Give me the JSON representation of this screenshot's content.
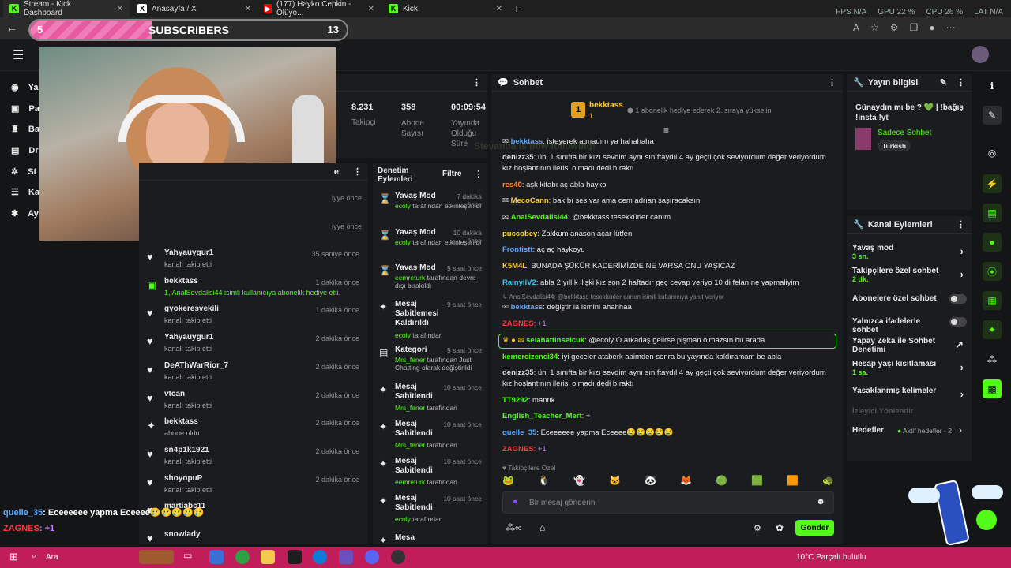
{
  "browser": {
    "tabs": [
      {
        "label": "Stream - Kick Dashboard",
        "icon": "kick-icon"
      },
      {
        "label": "Anasayfa / X",
        "icon": "x-icon"
      },
      {
        "label": "(177) Hayko Cepkin - Ölüyo...",
        "icon": "youtube-icon"
      },
      {
        "label": "Kick",
        "icon": "kick-icon"
      }
    ],
    "stats": {
      "fps": "FPS N/A",
      "gpu": "GPU 22 %",
      "cpu": "CPU 26 %",
      "lat": "LAT N/A"
    }
  },
  "overlay": {
    "subscribers_label": "SUBSCRIBERS",
    "sub_current": "5",
    "sub_goal": "13",
    "chat_line1_user": "quelle_35",
    "chat_line1_text": ": Eceeeeee yapma Eceeee😢😢😢😢😢",
    "chat_line2_user": "ZAGNES",
    "chat_line2_text": ": +1"
  },
  "nav": {
    "items": [
      "Ya",
      "Pa",
      "Ba",
      "Dr",
      "St",
      "Ka",
      "Ay"
    ]
  },
  "stats": [
    {
      "value": "8.231",
      "label": "Takipçi"
    },
    {
      "value": "358",
      "label": "Abone Sayısı"
    },
    {
      "value": "00:09:54",
      "label": "Yayında Olduğu Süre"
    }
  ],
  "feed": {
    "header_suffix": "e",
    "partial_time": "iyye önce",
    "items": [
      {
        "name": "Yahyauygur1",
        "sub": "kanalı takip etti",
        "time": "35 saniye önce",
        "icon": "heart"
      },
      {
        "name": "bekktass",
        "sub": "1, AnalSevdalisi44 isimli kullanıcıya abonelik hediye etti.",
        "time": "1 dakika önce",
        "icon": "gift"
      },
      {
        "name": "gyokeresvekili",
        "sub": "kanalı takip etti",
        "time": "1 dakika önce",
        "icon": "heart"
      },
      {
        "name": "Yahyauygur1",
        "sub": "kanalı takip etti",
        "time": "2 dakika önce",
        "icon": "heart"
      },
      {
        "name": "DeAThWarRior_7",
        "sub": "kanalı takip etti",
        "time": "2 dakika önce",
        "icon": "heart"
      },
      {
        "name": "vtcan",
        "sub": "kanalı takip etti",
        "time": "2 dakika önce",
        "icon": "heart"
      },
      {
        "name": "bekktass",
        "sub": "abone oldu",
        "time": "2 dakika önce",
        "icon": "star"
      },
      {
        "name": "sn4p1k1921",
        "sub": "kanalı takip etti",
        "time": "2 dakika önce",
        "icon": "heart"
      },
      {
        "name": "shoyopuP",
        "sub": "kanalı takip etti",
        "time": "2 dakika önce",
        "icon": "heart"
      },
      {
        "name": "martiabc11",
        "sub": "",
        "time": "",
        "icon": "heart"
      },
      {
        "name": "snowlady",
        "sub": "",
        "time": "",
        "icon": "heart"
      }
    ]
  },
  "mod": {
    "title": "Denetim Eylemleri",
    "filter": "Filtre",
    "items": [
      {
        "title": "Yavaş Mod",
        "user": "ecoly",
        "sub": " tarafından etkinleştirildi",
        "time": "7 dakika önce"
      },
      {
        "title": "Yavaş Mod",
        "user": "ecoly",
        "sub": " tarafından etkinleştirildi",
        "time": "10 dakika önce"
      },
      {
        "title": "Yavaş Mod",
        "user": "eemreturk",
        "sub": " tarafından devre dışı bırakıldı",
        "time": "9 saat önce"
      },
      {
        "title": "Mesaj Sabitlemesi Kaldırıldı",
        "user": "ecoly",
        "sub": " tarafından",
        "time": "9 saat önce"
      },
      {
        "title": "Kategori",
        "user": "Mrs_fener",
        "sub": " tarafından Just Chatting olarak değiştirildi",
        "time": "9 saat önce"
      },
      {
        "title": "Mesaj Sabitlendi",
        "user": "Mrs_fener",
        "sub": " tarafından",
        "time": "10 saat önce"
      },
      {
        "title": "Mesaj Sabitlendi",
        "user": "Mrs_fener",
        "sub": " tarafından",
        "time": "10 saat önce"
      },
      {
        "title": "Mesaj Sabitlendi",
        "user": "eemreturk",
        "sub": " tarafından",
        "time": "10 saat önce"
      },
      {
        "title": "Mesaj Sabitlendi",
        "user": "ecoly",
        "sub": " tarafından",
        "time": "10 saat önce"
      },
      {
        "title": "Mesa",
        "user": "",
        "sub": "",
        "time": ""
      }
    ]
  },
  "chat": {
    "title": "Sohbet",
    "pinned_user": "bekktass",
    "pinned_count": "1",
    "pinned_text": "1 abonelik hediye ederek 2. sıraya yükselin",
    "ghost_text": "Stevanda is now following!",
    "messages": [
      {
        "user": "bekktass",
        "color": "#5aa8ff",
        "text": ": isteyerek atmadım ya hahahaha"
      },
      {
        "user": "denizz35",
        "color": "#dddddd",
        "text": ": üni 1 sınıfta bir kızı sevdim aynı sınıftaydıl 4 ay geçti çok seviyordum değer veriyordum kız hoşlantının ilerisi olmadı dedi bıraktı"
      },
      {
        "user": "res40",
        "color": "#ff8a3d",
        "text": ": aşk kitabı aç abla hayko"
      },
      {
        "user": "MecoCann",
        "color": "#ffcc33",
        "text": ": bak bı ses var ama cem adrıan şaşıracaksın"
      },
      {
        "user": "AnalSevdalisi44",
        "color": "#53fc18",
        "text": ": @bekktass tesekkürler canım"
      },
      {
        "user": "puccobey",
        "color": "#ffdd33",
        "text": ": Zakkum anason açar lütfen"
      },
      {
        "user": "Frontistt",
        "color": "#5aa8ff",
        "text": ": aç aç haykoyu"
      },
      {
        "user": "K5M4L",
        "color": "#ffcc33",
        "text": ": BUNADA ŞÜKÜR KADERİMİZDE NE VARSA ONU YAŞICAZ"
      },
      {
        "user": "RainyliV2",
        "color": "#33ccff",
        "text": ": abla 2 yıllık ilişki kız son 2 haftadır geç cevap veriyo 10 di felan ne yapmaliyim"
      },
      {
        "user": "bekktass",
        "color": "#5aa8ff",
        "text": ": değiştir la ismini ahahhaa"
      },
      {
        "user": "ZAGNES",
        "color": "#ff3b3b",
        "text": ": +1"
      },
      {
        "user": "selahattinselcuk",
        "color": "#53fc18",
        "text": ": @ecoiy O arkadaş gelirse pişman olmazsın bu arada"
      },
      {
        "user": "kemercizenci34",
        "color": "#53fc18",
        "text": ": iyi geceler ataberk abimden sonra bu yayında kaldıramam be abla"
      },
      {
        "user": "denizz35",
        "color": "#dddddd",
        "text": ": üni 1 sınıfta bir kızı sevdim aynı sınıftaydıl 4 ay geçti çok seviyordum değer veriyordum kız hoşlantının ilerisi olmadı dedi bıraktı"
      },
      {
        "user": "TT9292",
        "color": "#53fc18",
        "text": ": mantık"
      },
      {
        "user": "English_Teacher_Mert",
        "color": "#53fc18",
        "text": ": +"
      },
      {
        "user": "quelle_35",
        "color": "#5aa8ff",
        "text": ": Eceeeeee yapma Eceeee😢😢😢😢😢"
      },
      {
        "user": "ZAGNES",
        "color": "#ff3b3b",
        "text": ": +1"
      }
    ],
    "reply_hint": "AnalSevdalisi44: @bekktass tesekkürler canım isimli kullanıcıya yanıt veriyor",
    "followers_only": "Takipçilere Özel",
    "input_placeholder": "Bir mesaj gönderin",
    "send_label": "Gönder"
  },
  "stream_info": {
    "title": "Yayın bilgisi",
    "text": "Günaydın mı be ?  💚  | !bağış !insta !yt",
    "category": "Sadece Sohbet",
    "tag": "Turkish"
  },
  "channel_actions": {
    "title": "Kanal Eylemleri",
    "rows": [
      {
        "label": "Yavaş mod",
        "value": "3 sn."
      },
      {
        "label": "Takipçilere özel sohbet",
        "value": "2 dk."
      },
      {
        "label": "Abonelere özel sohbet",
        "value": ""
      },
      {
        "label": "Yalnızca ifadelerle sohbet",
        "value": ""
      },
      {
        "label": "Yapay Zeka ile Sohbet Denetimi",
        "value": ""
      },
      {
        "label": "Hesap yaşı kısıtlaması",
        "value": "1 sa."
      },
      {
        "label": "Yasaklanmış kelimeler",
        "value": ""
      }
    ],
    "viewer_label": "İzleyici Yönlendir",
    "goals_label": "Hedefler",
    "goals_value": "Aktif hedefler - 2"
  },
  "taskbar": {
    "search": "Ara",
    "weather": "10°C  Parçalı bulutlu"
  },
  "colors": {
    "accent": "#53fc18",
    "bg": "#141517",
    "panel": "#1b1c1f",
    "taskbar": "#c11d5a"
  }
}
